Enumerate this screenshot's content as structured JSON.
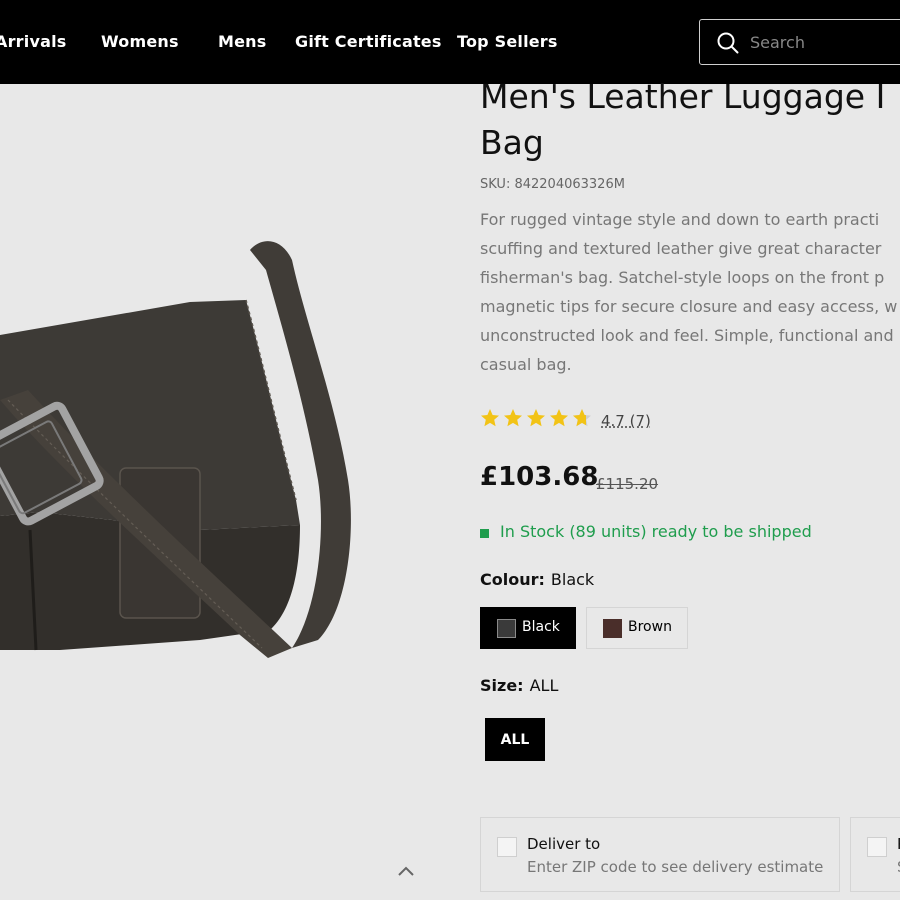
{
  "nav": {
    "items": [
      "Arrivals",
      "Womens",
      "Mens",
      "Gift Certificates",
      "Top Sellers"
    ],
    "search_placeholder": "Search"
  },
  "product": {
    "title_line1": "Men's Leather Luggage I",
    "title_line2": "Bag",
    "sku_label": "SKU:",
    "sku": "842204063326M",
    "description_lines": [
      "For rugged vintage style and down to earth practi",
      "scuffing and textured leather give great character",
      "fisherman's bag. Satchel-style loops on the front p",
      "magnetic tips for secure closure and easy access, w",
      "unconstructed look and feel. Simple, functional and",
      "casual bag."
    ],
    "rating_value": 4.7,
    "rating_text": "4.7 (7)",
    "price": "£103.68",
    "old_price": "£115.20",
    "stock_text": "In Stock (89 units) ready to be shipped"
  },
  "colour": {
    "label": "Colour:",
    "selected": "Black",
    "options": [
      {
        "label": "Black",
        "swatch": "#3a3a3a"
      },
      {
        "label": "Brown",
        "swatch": "#4a2e2a"
      }
    ]
  },
  "size": {
    "label": "Size:",
    "selected": "ALL",
    "options": [
      "ALL"
    ]
  },
  "delivery": {
    "title": "Deliver to",
    "subtitle": "Enter ZIP code to see delivery estimate"
  },
  "pickup": {
    "title": "P",
    "subtitle": "S"
  },
  "colors": {
    "header_bg": "#000000",
    "page_bg": "#e8e8e8",
    "star": "#f2c316",
    "in_stock": "#1f9d4d"
  }
}
